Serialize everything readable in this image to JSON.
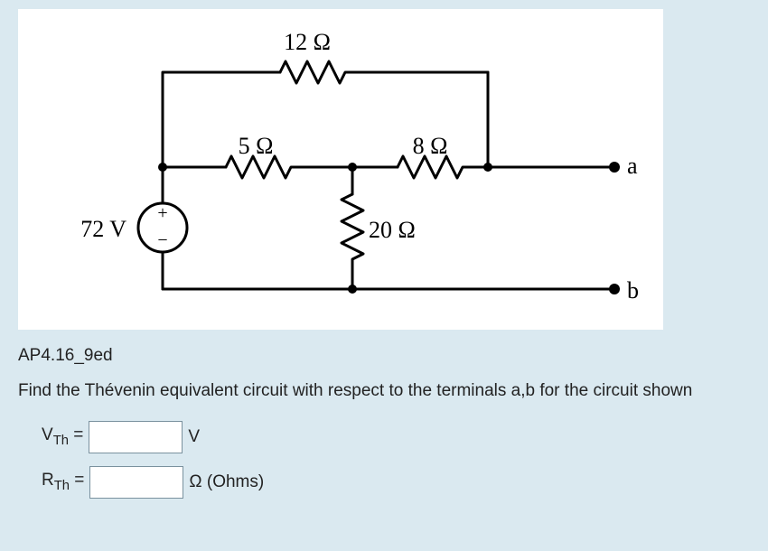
{
  "circuit": {
    "source_label": "72 V",
    "source_plus": "+",
    "source_minus": "−",
    "r_top": "12 Ω",
    "r_left": "5 Ω",
    "r_right": "8 Ω",
    "r_mid": "20 Ω",
    "terminal_a": "a",
    "terminal_b": "b"
  },
  "problem_id": "AP4.16_9ed",
  "prompt": "Find the Thévenin equivalent circuit with respect to the terminals a,b for the circuit shown",
  "fields": {
    "vth_prefix": "V",
    "vth_sub": "Th",
    "vth_eq": " =",
    "vth_unit": "V",
    "rth_prefix": "R",
    "rth_sub": "Th",
    "rth_eq": " =",
    "rth_unit": "Ω (Ohms)"
  }
}
